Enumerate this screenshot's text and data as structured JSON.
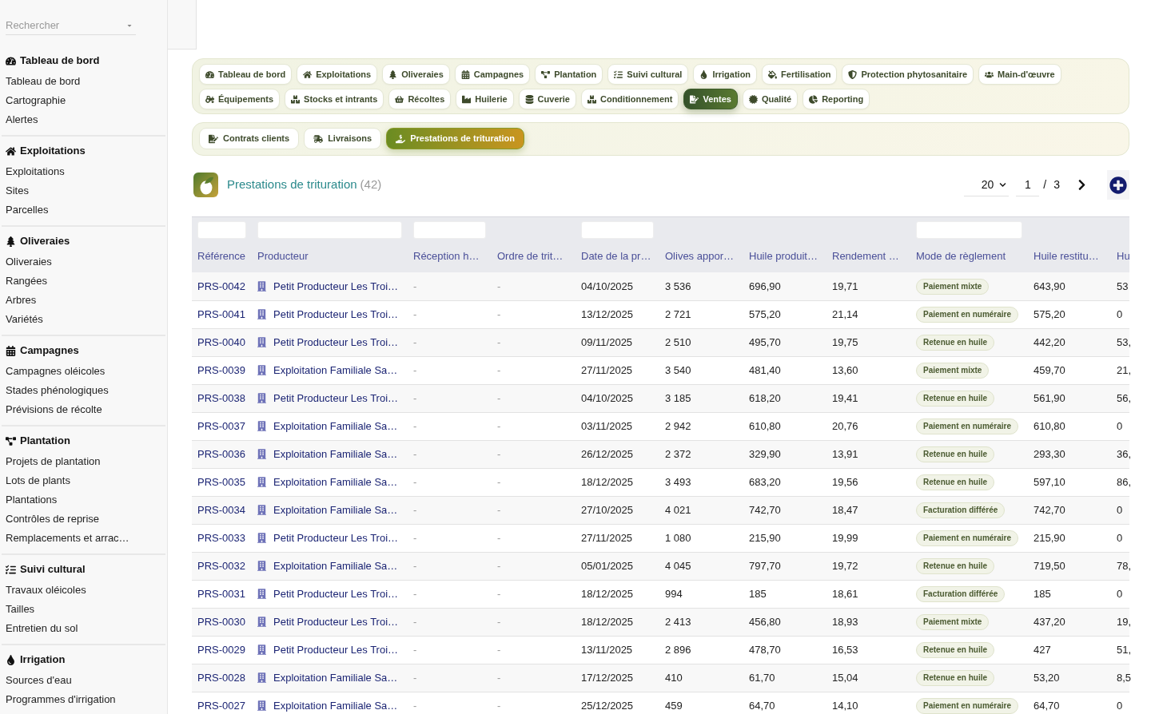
{
  "sidebar": {
    "search": {
      "placeholder": "Rechercher"
    },
    "sections": [
      {
        "title": "Tableau de bord",
        "items": [
          "Tableau de bord",
          "Cartographie",
          "Alertes"
        ]
      },
      {
        "title": "Exploitations",
        "items": [
          "Exploitations",
          "Sites",
          "Parcelles"
        ]
      },
      {
        "title": "Oliveraies",
        "items": [
          "Oliveraies",
          "Rangées",
          "Arbres",
          "Variétés"
        ]
      },
      {
        "title": "Campagnes",
        "items": [
          "Campagnes oléicoles",
          "Stades phénologiques",
          "Prévisions de récolte"
        ]
      },
      {
        "title": "Plantation",
        "items": [
          "Projets de plantation",
          "Lots de plants",
          "Plantations",
          "Contrôles de reprise",
          "Remplacements et arrac…"
        ]
      },
      {
        "title": "Suivi cultural",
        "items": [
          "Travaux oléicoles",
          "Tailles",
          "Entretien du sol"
        ]
      },
      {
        "title": "Irrigation",
        "items": [
          "Sources d'eau",
          "Programmes d'irrigation"
        ]
      }
    ]
  },
  "module_tab_rows": [
    {
      "tabs": [
        {
          "label": "Tableau de bord",
          "selected": false
        },
        {
          "label": "Exploitations",
          "selected": false
        },
        {
          "label": "Oliveraies",
          "selected": false
        },
        {
          "label": "Campagnes",
          "selected": false
        },
        {
          "label": "Plantation",
          "selected": false
        },
        {
          "label": "Suivi cultural",
          "selected": false
        },
        {
          "label": "Irrigation",
          "selected": false
        },
        {
          "label": "Fertilisation",
          "selected": false
        },
        {
          "label": "Protection phytosanitaire",
          "selected": false
        },
        {
          "label": "Main-d'œuvre",
          "selected": false
        }
      ]
    },
    {
      "tabs": [
        {
          "label": "Équipements",
          "selected": false
        },
        {
          "label": "Stocks et intrants",
          "selected": false
        },
        {
          "label": "Récoltes",
          "selected": false
        },
        {
          "label": "Huilerie",
          "selected": false
        },
        {
          "label": "Cuverie",
          "selected": false
        },
        {
          "label": "Conditionnement",
          "selected": false
        },
        {
          "label": "Ventes",
          "selected": true
        },
        {
          "label": "Qualité",
          "selected": false
        },
        {
          "label": "Reporting",
          "selected": false
        }
      ]
    }
  ],
  "sub_tabs": [
    {
      "label": "Contrats clients",
      "selected": false
    },
    {
      "label": "Livraisons",
      "selected": false
    },
    {
      "label": "Prestations de trituration",
      "selected": true
    }
  ],
  "list_header": {
    "title": "Prestations de trituration",
    "count": "(42)"
  },
  "pagination": {
    "page_size": "20",
    "page": "1",
    "separator": "/",
    "total_pages": "3"
  },
  "table": {
    "columns": [
      {
        "label": "Référence",
        "filter": true,
        "kind": "reference"
      },
      {
        "label": "Producteur",
        "filter": true,
        "kind": "producer"
      },
      {
        "label": "Réception h…",
        "filter": true,
        "kind": "muted"
      },
      {
        "label": "Ordre de trit…",
        "filter": false,
        "kind": "muted"
      },
      {
        "label": "Date de la pr…",
        "filter": true,
        "kind": "text"
      },
      {
        "label": "Olives appor…",
        "filter": false,
        "kind": "text"
      },
      {
        "label": "Huile produit…",
        "filter": false,
        "kind": "text"
      },
      {
        "label": "Rendement …",
        "filter": false,
        "kind": "text"
      },
      {
        "label": "Mode de règlement",
        "filter": true,
        "kind": "badge"
      },
      {
        "label": "Huile restitu…",
        "filter": false,
        "kind": "text"
      },
      {
        "label": "Hu",
        "filter": false,
        "kind": "text"
      }
    ],
    "rows": [
      [
        "PRS-0042",
        "Petit Producteur Les Troi…",
        "-",
        "-",
        "04/10/2025",
        "3 536",
        "696,90",
        "19,71",
        "Paiement mixte",
        "643,90",
        "53"
      ],
      [
        "PRS-0041",
        "Petit Producteur Les Troi…",
        "-",
        "-",
        "13/12/2025",
        "2 721",
        "575,20",
        "21,14",
        "Paiement en numéraire",
        "575,20",
        "0"
      ],
      [
        "PRS-0040",
        "Petit Producteur Les Troi…",
        "-",
        "-",
        "09/11/2025",
        "2 510",
        "495,70",
        "19,75",
        "Retenue en huile",
        "442,20",
        "53,"
      ],
      [
        "PRS-0039",
        "Exploitation Familiale Sa…",
        "-",
        "-",
        "27/11/2025",
        "3 540",
        "481,40",
        "13,60",
        "Paiement mixte",
        "459,70",
        "21,"
      ],
      [
        "PRS-0038",
        "Petit Producteur Les Troi…",
        "-",
        "-",
        "04/10/2025",
        "3 185",
        "618,20",
        "19,41",
        "Retenue en huile",
        "561,90",
        "56,"
      ],
      [
        "PRS-0037",
        "Exploitation Familiale Sa…",
        "-",
        "-",
        "03/11/2025",
        "2 942",
        "610,80",
        "20,76",
        "Paiement en numéraire",
        "610,80",
        "0"
      ],
      [
        "PRS-0036",
        "Exploitation Familiale Sa…",
        "-",
        "-",
        "26/12/2025",
        "2 372",
        "329,90",
        "13,91",
        "Retenue en huile",
        "293,30",
        "36,"
      ],
      [
        "PRS-0035",
        "Exploitation Familiale Sa…",
        "-",
        "-",
        "18/12/2025",
        "3 493",
        "683,20",
        "19,56",
        "Retenue en huile",
        "597,10",
        "86,"
      ],
      [
        "PRS-0034",
        "Exploitation Familiale Sa…",
        "-",
        "-",
        "27/10/2025",
        "4 021",
        "742,70",
        "18,47",
        "Facturation différée",
        "742,70",
        "0"
      ],
      [
        "PRS-0033",
        "Petit Producteur Les Troi…",
        "-",
        "-",
        "27/11/2025",
        "1 080",
        "215,90",
        "19,99",
        "Paiement en numéraire",
        "215,90",
        "0"
      ],
      [
        "PRS-0032",
        "Exploitation Familiale Sa…",
        "-",
        "-",
        "05/01/2025",
        "4 045",
        "797,70",
        "19,72",
        "Retenue en huile",
        "719,50",
        "78,"
      ],
      [
        "PRS-0031",
        "Petit Producteur Les Troi…",
        "-",
        "-",
        "18/12/2025",
        "994",
        "185",
        "18,61",
        "Facturation différée",
        "185",
        "0"
      ],
      [
        "PRS-0030",
        "Petit Producteur Les Troi…",
        "-",
        "-",
        "18/12/2025",
        "2 413",
        "456,80",
        "18,93",
        "Paiement mixte",
        "437,20",
        "19,"
      ],
      [
        "PRS-0029",
        "Petit Producteur Les Troi…",
        "-",
        "-",
        "13/11/2025",
        "2 896",
        "478,70",
        "16,53",
        "Retenue en huile",
        "427",
        "51,"
      ],
      [
        "PRS-0028",
        "Exploitation Familiale Sa…",
        "-",
        "-",
        "17/12/2025",
        "410",
        "61,70",
        "15,04",
        "Retenue en huile",
        "53,20",
        "8,5"
      ],
      [
        "PRS-0027",
        "Exploitation Familiale Sa…",
        "-",
        "-",
        "25/12/2025",
        "459",
        "64,70",
        "14,10",
        "Paiement en numéraire",
        "64,70",
        "0"
      ]
    ]
  }
}
